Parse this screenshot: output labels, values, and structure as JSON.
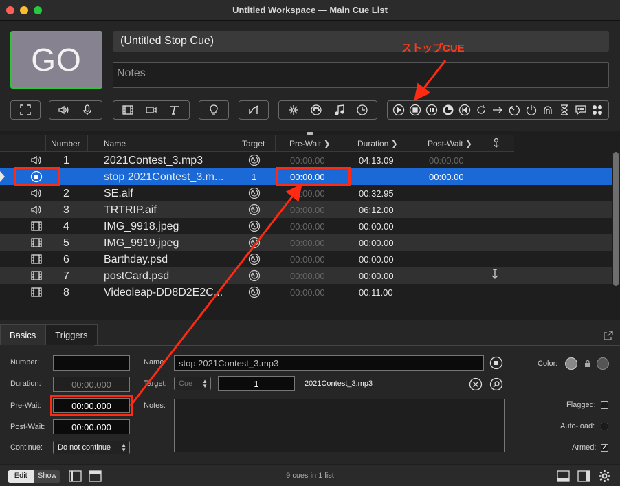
{
  "window": {
    "title": "Untitled Workspace — Main Cue List"
  },
  "header": {
    "go_label": "GO",
    "cue_name": "(Untitled Stop Cue)",
    "notes_placeholder": "Notes",
    "annotation": "ストップCUE"
  },
  "toolbar": {
    "groups": [
      [
        "fullscreen-icon"
      ],
      [
        "audio-icon",
        "mic-icon"
      ],
      [
        "video-icon",
        "camera-icon",
        "text-icon"
      ],
      [
        "light-icon"
      ],
      [
        "fade-icon"
      ],
      [
        "network-icon",
        "midi-icon",
        "music-icon",
        "timecode-icon"
      ],
      [
        "start-icon",
        "stop-icon",
        "pause-icon",
        "load-icon",
        "reset-icon",
        "devamp-icon",
        "goto-icon",
        "target-icon",
        "arm-icon",
        "disarm-icon",
        "wait-icon",
        "memo-icon",
        "script-icon"
      ]
    ]
  },
  "list": {
    "columns": [
      "Number",
      "Name",
      "Target",
      "Pre-Wait",
      "Duration",
      "Post-Wait"
    ],
    "rows": [
      {
        "icon": "audio-icon",
        "number": "1",
        "name": "2021Contest_3.mp3",
        "target": "",
        "prewait": "00:00.00",
        "duration": "04:13.09",
        "postwait": "00:00.00",
        "selected": false
      },
      {
        "icon": "stop-icon",
        "number": "",
        "name": "stop 2021Contest_3.m...",
        "target": "1",
        "prewait": "00:00.00",
        "duration": "",
        "postwait": "00:00.00",
        "selected": true
      },
      {
        "icon": "audio-icon",
        "number": "2",
        "name": "SE.aif",
        "target": "",
        "prewait": "00:00.00",
        "duration": "00:32.95",
        "postwait": "",
        "selected": false
      },
      {
        "icon": "audio-icon",
        "number": "3",
        "name": "TRTRIP.aif",
        "target": "",
        "prewait": "00:00.00",
        "duration": "06:12.00",
        "postwait": "",
        "selected": false
      },
      {
        "icon": "video-icon",
        "number": "4",
        "name": "IMG_9918.jpeg",
        "target": "",
        "prewait": "00:00.00",
        "duration": "00:00.00",
        "postwait": "",
        "selected": false
      },
      {
        "icon": "video-icon",
        "number": "5",
        "name": "IMG_9919.jpeg",
        "target": "",
        "prewait": "00:00.00",
        "duration": "00:00.00",
        "postwait": "",
        "selected": false
      },
      {
        "icon": "video-icon",
        "number": "6",
        "name": "Barthday.psd",
        "target": "",
        "prewait": "00:00.00",
        "duration": "00:00.00",
        "postwait": "",
        "selected": false
      },
      {
        "icon": "video-icon",
        "number": "7",
        "name": "postCard.psd",
        "target": "",
        "prewait": "00:00.00",
        "duration": "00:00.00",
        "postwait": "",
        "selected": false
      },
      {
        "icon": "video-icon",
        "number": "8",
        "name": "Videoleap-DD8D2E2C...",
        "target": "",
        "prewait": "00:00.00",
        "duration": "00:11.00",
        "postwait": "",
        "selected": false
      }
    ]
  },
  "inspector": {
    "tabs": [
      "Basics",
      "Triggers"
    ],
    "labels": {
      "number": "Number:",
      "duration": "Duration:",
      "prewait": "Pre-Wait:",
      "postwait": "Post-Wait:",
      "continue": "Continue:",
      "name": "Name:",
      "target": "Target:",
      "notes": "Notes:",
      "color": "Color:",
      "flagged": "Flagged:",
      "autoload": "Auto-load:",
      "armed": "Armed:"
    },
    "values": {
      "number": "",
      "duration": "00:00.000",
      "prewait": "00:00.000",
      "postwait": "00:00.000",
      "continue": "Do not continue",
      "name": "stop 2021Contest_3.mp3",
      "target_mode": "Cue",
      "target_number": "1",
      "target_name": "2021Contest_3.mp3"
    },
    "flagged": false,
    "autoload": false,
    "armed": true
  },
  "status": {
    "edit": "Edit",
    "show": "Show",
    "text": "9 cues in 1 list"
  }
}
